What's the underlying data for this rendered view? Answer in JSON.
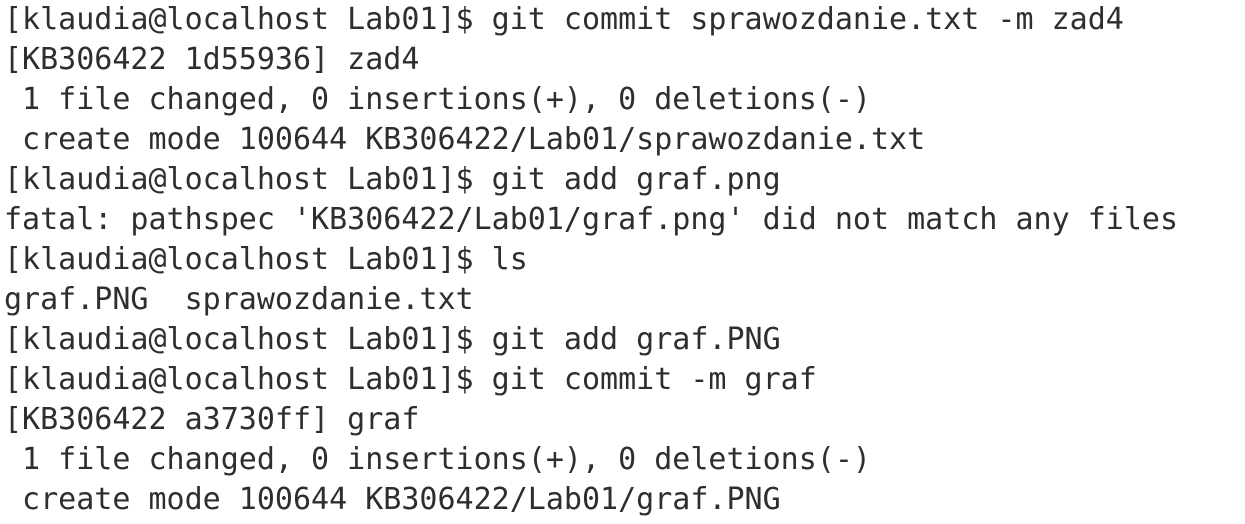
{
  "terminal": {
    "lines": [
      "[klaudia@localhost Lab01]$ git commit sprawozdanie.txt -m zad4",
      "[KB306422 1d55936] zad4",
      " 1 file changed, 0 insertions(+), 0 deletions(-)",
      " create mode 100644 KB306422/Lab01/sprawozdanie.txt",
      "[klaudia@localhost Lab01]$ git add graf.png",
      "fatal: pathspec 'KB306422/Lab01/graf.png' did not match any files",
      "[klaudia@localhost Lab01]$ ls",
      "graf.PNG  sprawozdanie.txt",
      "[klaudia@localhost Lab01]$ git add graf.PNG",
      "[klaudia@localhost Lab01]$ git commit -m graf",
      "[KB306422 a3730ff] graf",
      " 1 file changed, 0 insertions(+), 0 deletions(-)",
      " create mode 100644 KB306422/Lab01/graf.PNG"
    ]
  }
}
